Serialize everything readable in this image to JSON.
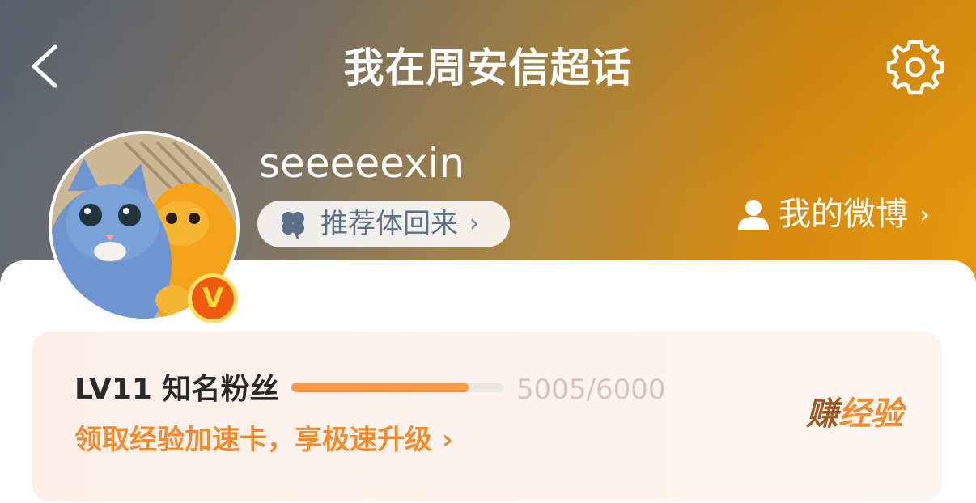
{
  "header": {
    "title": "我在周安信超话",
    "back_icon": "chevron-left-icon",
    "settings_icon": "gear-icon",
    "gradient_colors": [
      "#5e6673",
      "#a98543",
      "#e89a0e"
    ]
  },
  "profile": {
    "username": "seeeeexin",
    "verified_badge": "V",
    "recommend_pill": {
      "icon": "clover-icon",
      "label": "推荐体回来",
      "chevron": "›"
    },
    "my_weibo": {
      "icon": "person-icon",
      "label": "我的微博",
      "chevron": "›"
    }
  },
  "level": {
    "title": "LV11 知名粉丝",
    "progress_current": 5005,
    "progress_max": 6000,
    "progress_text": "5005/6000",
    "progress_color": "#fb9a4c",
    "boost_link": "领取经验加速卡，享极速升级 ›",
    "earn_exp_part1": "赚",
    "earn_exp_part2": "经验"
  }
}
